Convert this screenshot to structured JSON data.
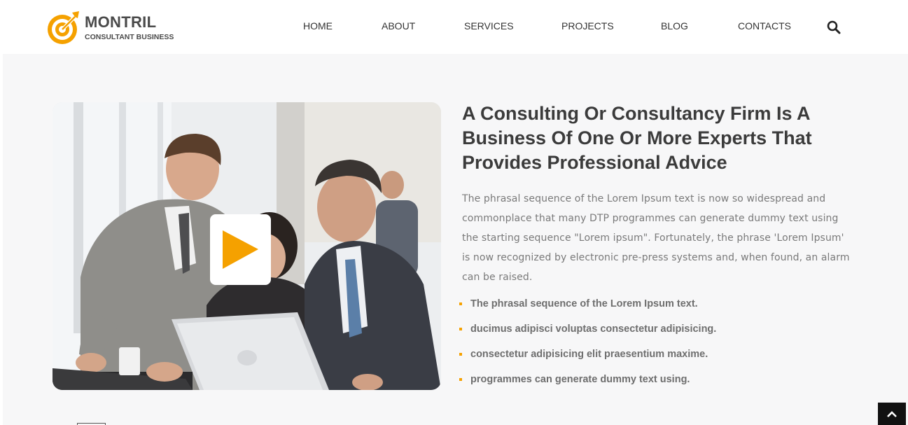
{
  "brand": {
    "name": "MONTRIL",
    "tagline": "CONSULTANT BUSINESS",
    "logo_icon": "target-arrow-icon",
    "accent_color": "#f5a100"
  },
  "nav": {
    "items": [
      {
        "label": "HOME"
      },
      {
        "label": "ABOUT"
      },
      {
        "label": "SERVICES"
      },
      {
        "label": "PROJECTS"
      },
      {
        "label": "BLOG"
      },
      {
        "label": "CONTACTS"
      }
    ],
    "search_icon": "search-icon"
  },
  "hero": {
    "image_icon": "office-team-photo",
    "play_icon": "play-icon",
    "heading": "A Consulting Or Consultancy Firm Is A Business Of One Or More Experts That Provides Professional Advice",
    "paragraph": "The phrasal sequence of the Lorem Ipsum text is now so widespread and commonplace that many DTP programmes can generate dummy text using the starting sequence \"Lorem ipsum\". Fortunately, the phrase 'Lorem Ipsum' is now recognized by electronic pre-press systems and, when found, an alarm can be raised.",
    "bullets": [
      {
        "text": "The phrasal sequence of the Lorem Ipsum text."
      },
      {
        "text": "ducimus adipisci voluptas consectetur adipisicing."
      },
      {
        "text": "consectetur adipisicing elit praesentium maxime."
      },
      {
        "text": "programmes can generate dummy text using."
      }
    ]
  },
  "scroll_top": {
    "icon": "chevron-up-icon"
  },
  "colors": {
    "section_bg": "#f7f7f8",
    "heading": "#3b3b3b",
    "body": "#7a7a7a",
    "scroll_button": "#111111"
  }
}
